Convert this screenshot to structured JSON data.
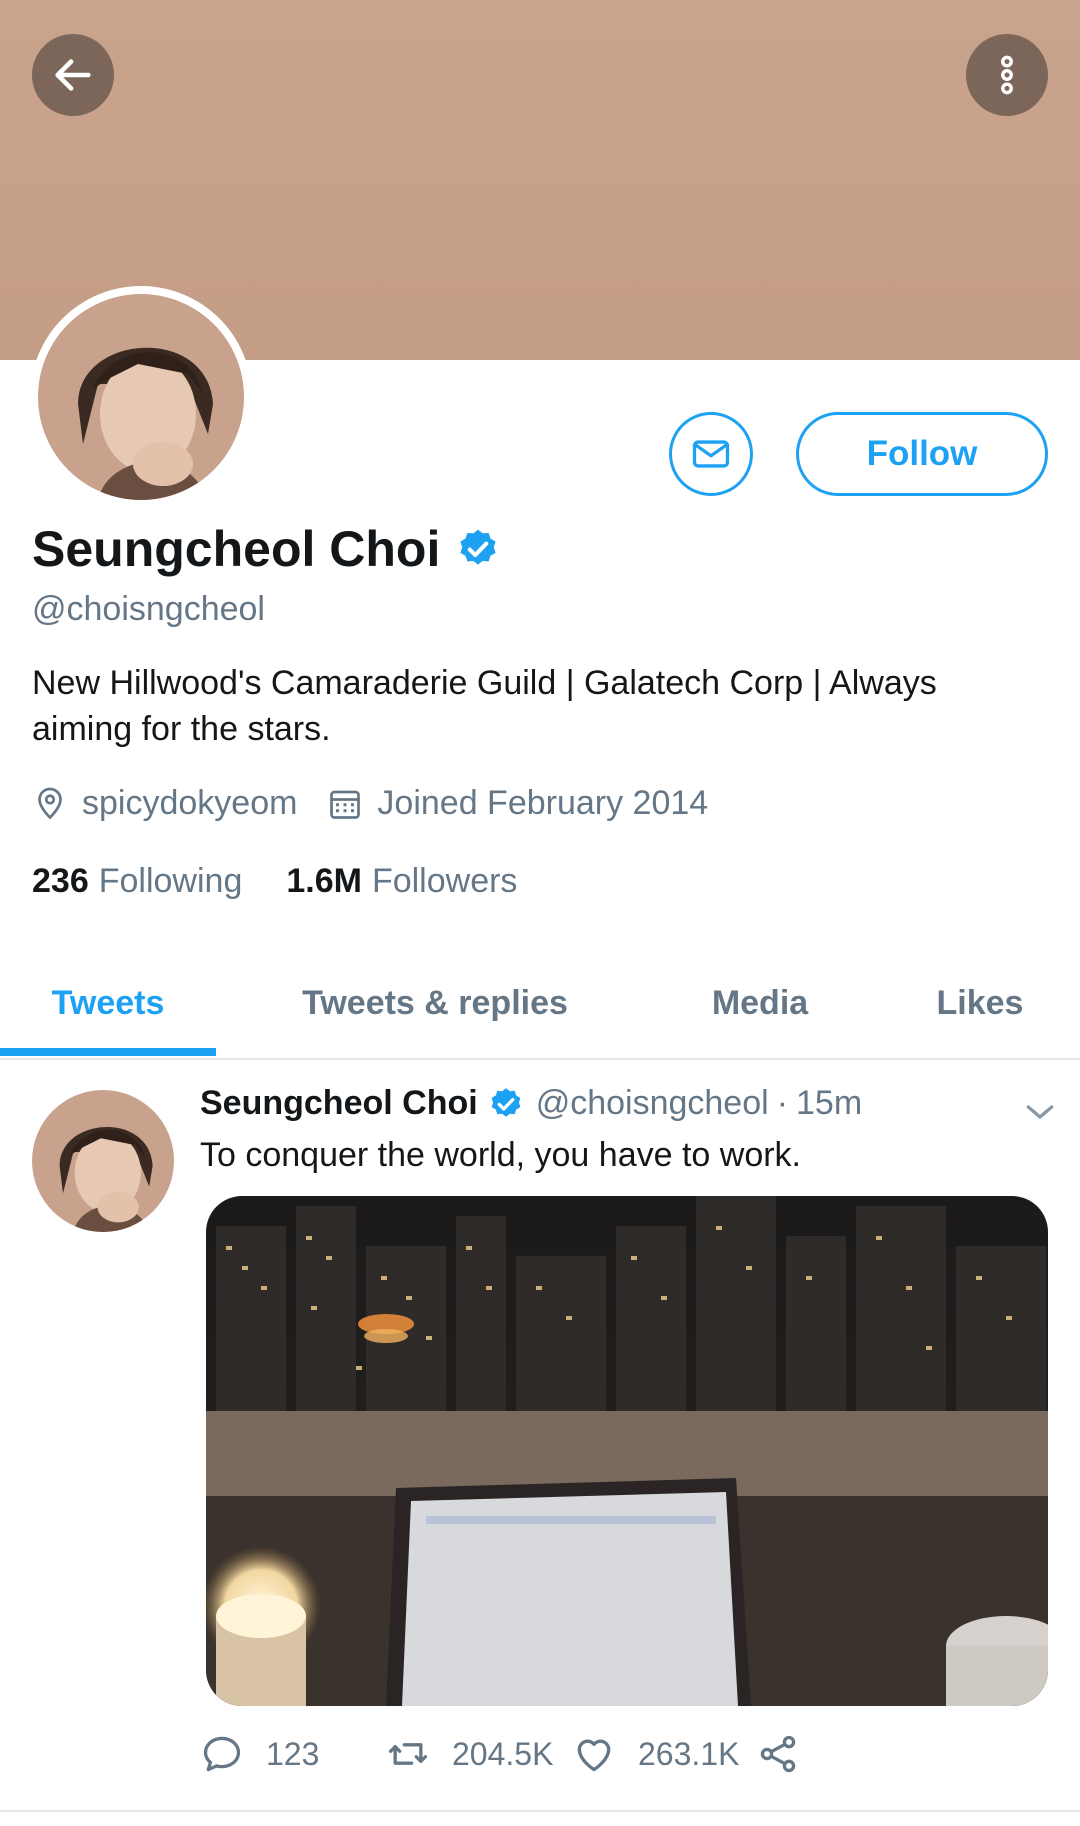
{
  "header": {
    "back_icon": "arrow-left-icon",
    "more_icon": "more-vertical-icon",
    "banner_color": "#c9a48c"
  },
  "profile": {
    "name": "Seungcheol Choi",
    "verified": true,
    "handle": "@choisngcheol",
    "bio": "New Hillwood's Camaraderie Guild | Galatech Corp | Always aiming for the stars.",
    "location": "spicydokyeom",
    "joined": "Joined February 2014",
    "following_count": "236",
    "following_label": "Following",
    "followers_count": "1.6M",
    "followers_label": "Followers"
  },
  "actions": {
    "follow_label": "Follow",
    "message_icon": "mail-icon"
  },
  "tabs": [
    {
      "label": "Tweets",
      "active": true
    },
    {
      "label": "Tweets & replies",
      "active": false
    },
    {
      "label": "Media",
      "active": false
    },
    {
      "label": "Likes",
      "active": false
    }
  ],
  "tweet": {
    "name": "Seungcheol Choi",
    "handle": "@choisngcheol",
    "separator": "·",
    "time": "15m",
    "text": "To conquer the world, you have to work.",
    "replies": "123",
    "retweets": "204.5K",
    "likes": "263.1K"
  },
  "colors": {
    "accent": "#1da1f2",
    "secondary_text": "#657786",
    "primary_text": "#14171a"
  }
}
